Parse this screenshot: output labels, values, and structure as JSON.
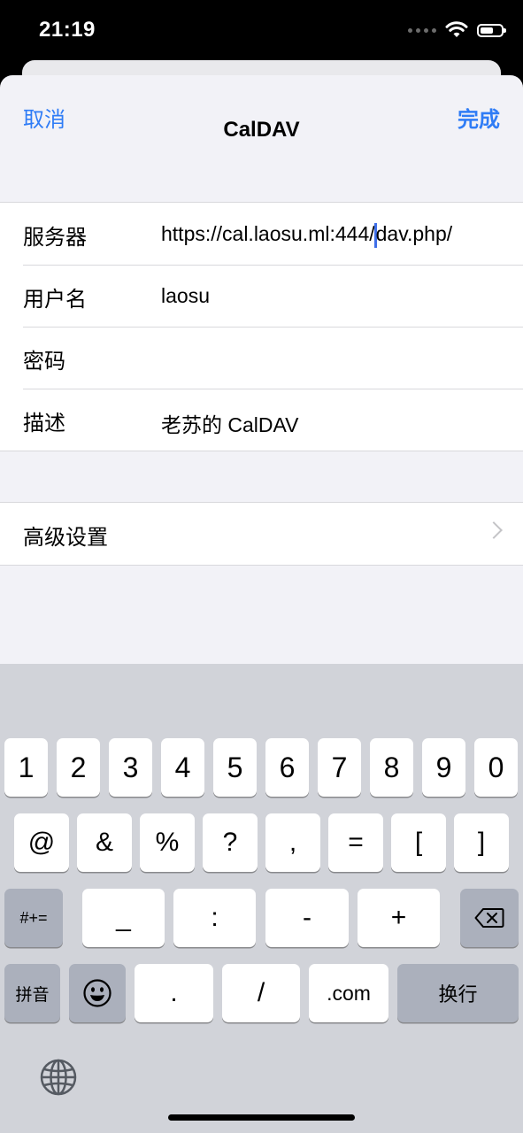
{
  "status_bar": {
    "time": "21:19"
  },
  "nav": {
    "cancel": "取消",
    "title": "CalDAV",
    "done": "完成"
  },
  "form": {
    "server": {
      "label": "服务器",
      "value_before_cursor": "https://cal.laosu.ml:444/",
      "value_after_cursor": "dav.php/"
    },
    "username": {
      "label": "用户名",
      "value": "laosu"
    },
    "password": {
      "label": "密码",
      "value": ""
    },
    "description": {
      "label": "描述",
      "value": "老苏的 CalDAV"
    }
  },
  "advanced": {
    "label": "高级设置"
  },
  "keyboard": {
    "row1": [
      "1",
      "2",
      "3",
      "4",
      "5",
      "6",
      "7",
      "8",
      "9",
      "0"
    ],
    "row2": [
      "@",
      "&",
      "%",
      "?",
      ",",
      "=",
      "[",
      "]"
    ],
    "row3": [
      "_",
      ":",
      "-",
      "+"
    ],
    "mode_switch": "#+=",
    "row4": {
      "pinyin": "拼音",
      "period": ".",
      "slash": "/",
      "dotcom": ".com",
      "return": "换行"
    }
  },
  "icons": {
    "wifi": "wifi-icon",
    "battery": "battery-icon",
    "backspace": "backspace-icon",
    "emoji": "emoji-icon",
    "globe": "globe-icon",
    "chevron": "chevron-right-icon"
  },
  "colors": {
    "accent": "#2f7cf6",
    "cursor": "#3f6fe8",
    "keyboard_bg": "#d1d3d9",
    "dark_key": "#abb0bc"
  }
}
